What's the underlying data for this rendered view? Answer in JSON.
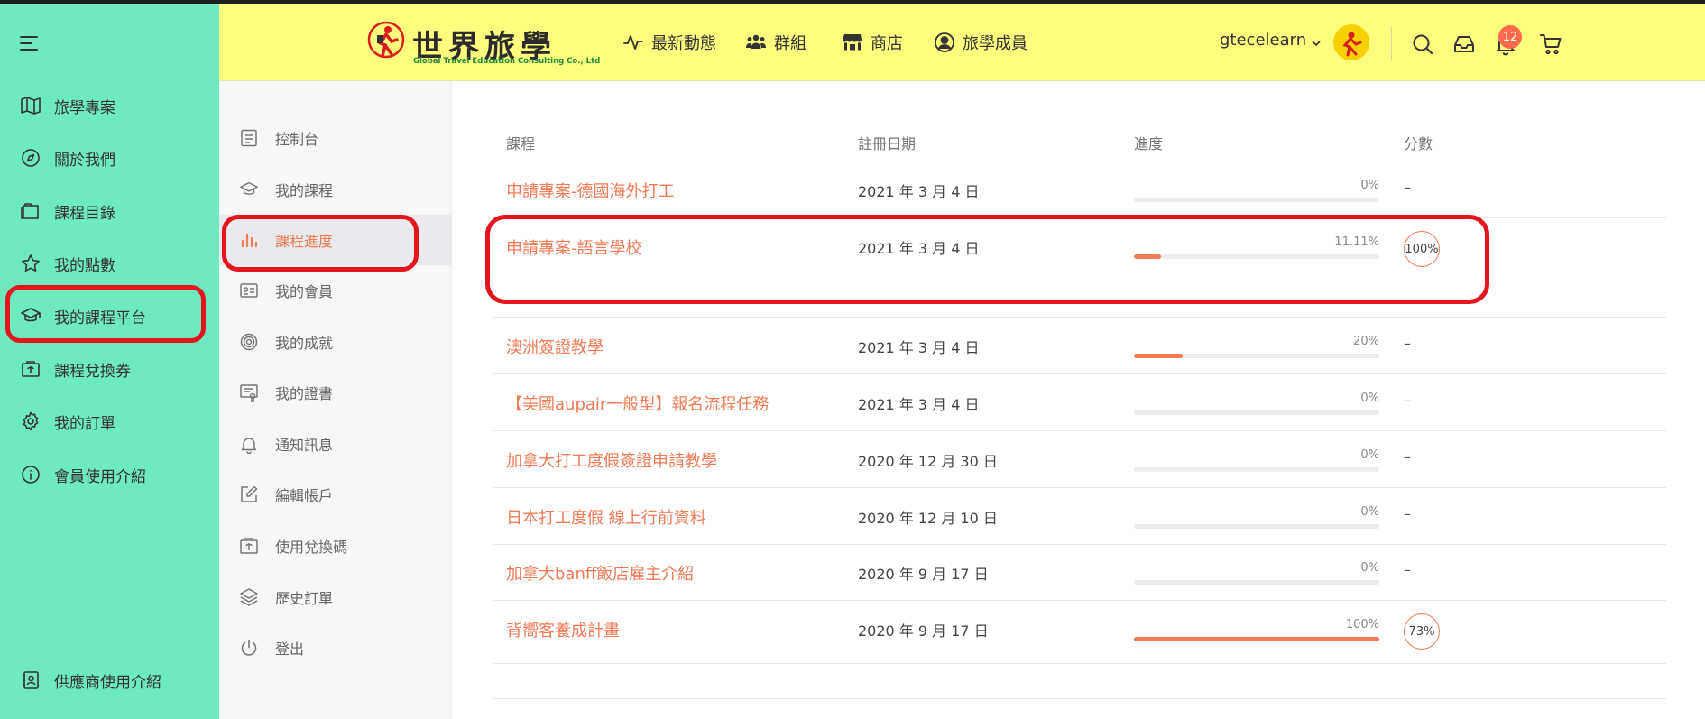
{
  "header": {
    "logo_title": "世界旅學",
    "logo_subtitle": "Global Travel Education Consulting Co., Ltd",
    "nav": [
      {
        "label": "最新動態",
        "icon": "activity-icon"
      },
      {
        "label": "群組",
        "icon": "users-icon"
      },
      {
        "label": "商店",
        "icon": "store-icon"
      },
      {
        "label": "旅學成員",
        "icon": "user-circle-icon"
      }
    ],
    "username": "gtecelearn",
    "notification_count": "12"
  },
  "sidebar": {
    "items": [
      {
        "label": "旅學專案",
        "icon": "map-icon"
      },
      {
        "label": "關於我們",
        "icon": "compass-icon"
      },
      {
        "label": "課程目錄",
        "icon": "folder-icon"
      },
      {
        "label": "我的點數",
        "icon": "star-icon"
      },
      {
        "label": "我的課程平台",
        "icon": "graduation-cap-icon"
      },
      {
        "label": "課程兌換券",
        "icon": "coupon-icon"
      },
      {
        "label": "我的訂單",
        "icon": "gear-icon"
      },
      {
        "label": "會員使用介紹",
        "icon": "info-icon"
      }
    ],
    "footer_item": {
      "label": "供應商使用介紹",
      "icon": "contact-book-icon"
    }
  },
  "subnav": {
    "items": [
      {
        "label": "控制台",
        "icon": "dashboard-icon"
      },
      {
        "label": "我的課程",
        "icon": "graduation-cap-icon"
      },
      {
        "label": "課程進度",
        "icon": "bar-chart-icon"
      },
      {
        "label": "我的會員",
        "icon": "id-card-icon"
      },
      {
        "label": "我的成就",
        "icon": "target-icon"
      },
      {
        "label": "我的證書",
        "icon": "certificate-icon"
      },
      {
        "label": "通知訊息",
        "icon": "bell-icon"
      },
      {
        "label": "編輯帳戶",
        "icon": "edit-icon"
      },
      {
        "label": "使用兌換碼",
        "icon": "coupon-icon"
      },
      {
        "label": "歷史訂單",
        "icon": "layers-icon"
      },
      {
        "label": "登出",
        "icon": "power-icon"
      }
    ],
    "active_index": 2
  },
  "table": {
    "columns": [
      "課程",
      "註冊日期",
      "進度",
      "分數"
    ],
    "rows": [
      {
        "course": "申請專案-德國海外打工",
        "date": "2021 年 3 月 4 日",
        "progress_label": "0%",
        "progress": 0,
        "score": "–"
      },
      {
        "course": "申請專案-語言學校",
        "date": "2021 年 3 月 4 日",
        "progress_label": "11.11%",
        "progress": 11.11,
        "score": "100%"
      },
      {
        "course": "澳洲簽證教學",
        "date": "2021 年 3 月 4 日",
        "progress_label": "20%",
        "progress": 20,
        "score": "–"
      },
      {
        "course": "【美國aupair一般型】報名流程任務",
        "date": "2021 年 3 月 4 日",
        "progress_label": "0%",
        "progress": 0,
        "score": "–"
      },
      {
        "course": "加拿大打工度假簽證申請教學",
        "date": "2020 年 12 月 30 日",
        "progress_label": "0%",
        "progress": 0,
        "score": "–"
      },
      {
        "course": "日本打工度假 線上行前資料",
        "date": "2020 年 12 月 10 日",
        "progress_label": "0%",
        "progress": 0,
        "score": "–"
      },
      {
        "course": "加拿大banff飯店雇主介紹",
        "date": "2020 年 9 月 17 日",
        "progress_label": "0%",
        "progress": 0,
        "score": "–"
      },
      {
        "course": "背嚮客養成計畫",
        "date": "2020 年 9 月 17 日",
        "progress_label": "100%",
        "progress": 100,
        "score": "73%"
      }
    ]
  },
  "colors": {
    "sidebar_bg": "#6fe9c0",
    "header_bg": "#fefd7e",
    "accent": "#f07b55",
    "highlight": "#e3151f"
  }
}
